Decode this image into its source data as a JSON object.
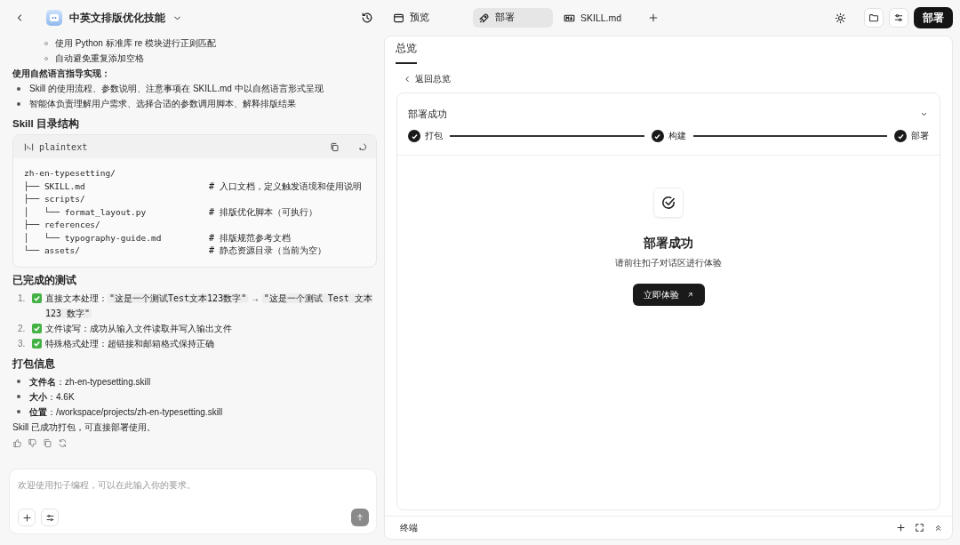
{
  "chat_header": {
    "title": "中英文排版优化技能"
  },
  "chat": [
    {
      "kind": "sub_bullet",
      "text": "使用 Python 标准库 re 模块进行正则匹配"
    },
    {
      "kind": "sub_bullet",
      "text": "自动避免重复添加空格"
    },
    {
      "kind": "label",
      "text": "使用自然语言指导实现："
    },
    {
      "kind": "bullet",
      "text": "Skill 的使用流程、参数说明、注意事项在 SKILL.md 中以自然语言形式呈现"
    },
    {
      "kind": "bullet",
      "text": "智能体负责理解用户需求、选择合适的参数调用脚本、解释排版结果"
    },
    {
      "kind": "heading",
      "text": "Skill 目录结构"
    },
    {
      "kind": "code",
      "language": "plaintext",
      "lines": [
        {
          "path": "zh-en-typesetting/"
        },
        {
          "path": "├── SKILL.md",
          "comment": "# 入口文档，定义触发语境和使用说明"
        },
        {
          "path": "├── scripts/"
        },
        {
          "path": "│   └── format_layout.py",
          "comment": "# 排版优化脚本（可执行）"
        },
        {
          "path": "├── references/"
        },
        {
          "path": "│   └── typography-guide.md",
          "comment": "# 排版规范参考文档"
        },
        {
          "path": "└── assets/",
          "comment": "# 静态资源目录（当前为空）"
        }
      ]
    },
    {
      "kind": "heading",
      "text": "已完成的测试"
    },
    {
      "kind": "numbered",
      "number": "1.",
      "done": true,
      "segments": [
        {
          "kind": "text",
          "text": "直接文本处理："
        },
        {
          "kind": "code",
          "text": "\"这是一个测试Test文本123数字\""
        },
        {
          "kind": "text",
          "text": " → "
        },
        {
          "kind": "code",
          "text": "\"这是一个测试 Test 文本 123 数字\""
        }
      ]
    },
    {
      "kind": "numbered",
      "number": "2.",
      "done": true,
      "segments": [
        {
          "kind": "text",
          "text": "文件读写：成功从输入文件读取并写入输出文件"
        }
      ]
    },
    {
      "kind": "numbered",
      "number": "3.",
      "done": true,
      "segments": [
        {
          "kind": "text",
          "text": "特殊格式处理：超链接和邮箱格式保持正确"
        }
      ]
    },
    {
      "kind": "heading",
      "text": "打包信息"
    },
    {
      "kind": "bullet",
      "text": "**文件名**：zh-en-typesetting.skill"
    },
    {
      "kind": "bullet",
      "text": "**大小**：4.6K"
    },
    {
      "kind": "bullet",
      "text": "**位置**：/workspace/projects/zh-en-typesetting.skill"
    },
    {
      "kind": "paragraph",
      "text": "Skill 已成功打包，可直接部署使用。"
    }
  ],
  "composer": {
    "placeholder": "欢迎使用扣子编程，可以在此输入你的要求。",
    "send_disabled": true
  },
  "toolbar": {
    "tabs": [
      {
        "label": "预览",
        "kind": "preview",
        "selected": false
      },
      {
        "label": "部署",
        "kind": "deploy",
        "selected": true
      },
      {
        "label": "SKILL.md",
        "kind": "file",
        "selected": false
      }
    ],
    "deploy_button": "部署"
  },
  "panel": {
    "tabs": [
      {
        "label": "总览",
        "selected": true
      }
    ],
    "back_link": "返回总览",
    "card": {
      "title": "部署成功",
      "steps": [
        {
          "label": "打包",
          "done": true
        },
        {
          "label": "构建",
          "done": true
        },
        {
          "label": "部署",
          "done": true
        }
      ]
    },
    "result": {
      "title": "部署成功",
      "subtitle": "请前往扣子对话区进行体验",
      "button": "立即体验"
    }
  },
  "terminal": {
    "label": "终端"
  }
}
